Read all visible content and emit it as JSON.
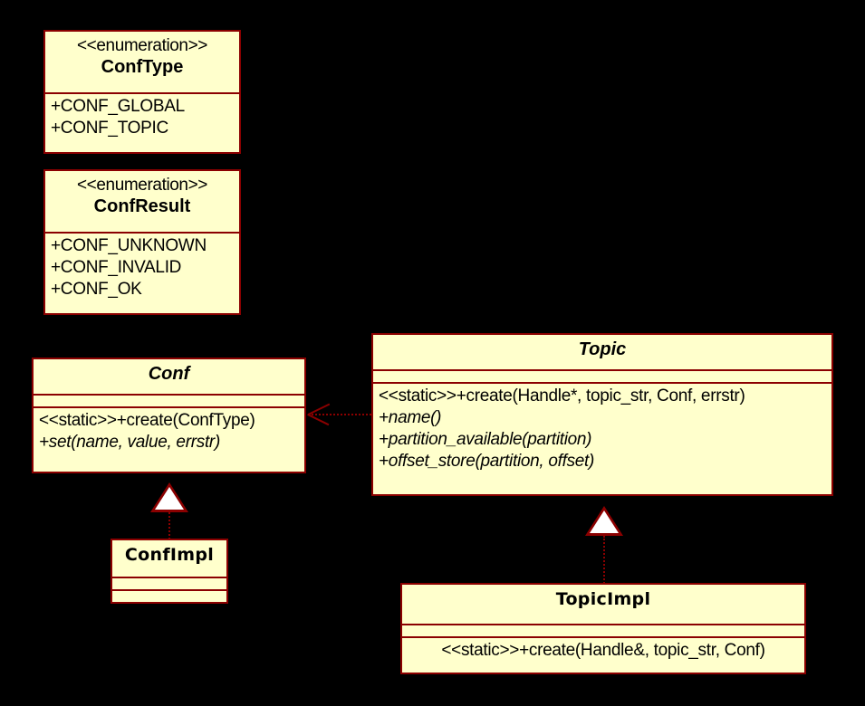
{
  "diagram": {
    "kind": "uml-class-diagram",
    "background_color": "#000000",
    "class_fill_color": "#FFFFCC",
    "class_border_color": "#8B0000",
    "text_color": "#000000",
    "connector_color": "#8B0000"
  },
  "classes": {
    "conf_type": {
      "stereotype": "<<enumeration>>",
      "name": "ConfType",
      "literals": [
        "+CONF_GLOBAL",
        "+CONF_TOPIC"
      ]
    },
    "conf_result": {
      "stereotype": "<<enumeration>>",
      "name": "ConfResult",
      "literals": [
        "+CONF_UNKNOWN",
        "+CONF_INVALID",
        "+CONF_OK"
      ]
    },
    "conf": {
      "name": "Conf",
      "abstract": true,
      "attributes": [],
      "operations": [
        {
          "text": "<<static>>+create(ConfType)",
          "abstract": false
        },
        {
          "text": "+set(name, value, errstr)",
          "abstract": true
        }
      ]
    },
    "topic": {
      "name": "Topic",
      "abstract": true,
      "attributes": [],
      "operations": [
        {
          "text": "<<static>>+create(Handle*, topic_str, Conf, errstr)",
          "abstract": false
        },
        {
          "text": "+name()",
          "abstract": true
        },
        {
          "text": "+partition_available(partition)",
          "abstract": true
        },
        {
          "text": "+offset_store(partition, offset)",
          "abstract": true
        }
      ]
    },
    "conf_impl": {
      "name": "ConfImpl",
      "abstract": false,
      "attributes": [],
      "operations": []
    },
    "topic_impl": {
      "name": "TopicImpl",
      "abstract": false,
      "attributes": [],
      "operations": [
        {
          "text": "<<static>>+create(Handle&, topic_str, Conf)",
          "abstract": false
        }
      ]
    }
  },
  "relationships": [
    {
      "id": "conf-impl-realizes-conf",
      "type": "realization",
      "from": "ConfImpl",
      "to": "Conf"
    },
    {
      "id": "topic-impl-realizes-topic",
      "type": "realization",
      "from": "TopicImpl",
      "to": "Topic"
    },
    {
      "id": "topic-depends-on-conf",
      "type": "dependency",
      "from": "Topic",
      "to": "Conf"
    }
  ]
}
